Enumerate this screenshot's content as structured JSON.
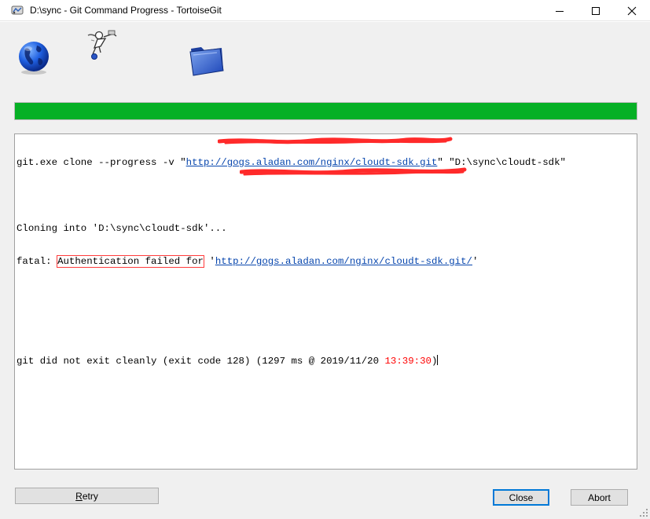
{
  "window": {
    "title": "D:\\sync - Git Command Progress - TortoiseGit"
  },
  "controls": {
    "minimize": "minimize-icon",
    "maximize": "maximize-icon",
    "close": "close-icon"
  },
  "animation_icons": [
    "globe-icon",
    "flying-figure-icon",
    "folder-icon"
  ],
  "progress": {
    "value": 1.0,
    "color": "#06b025"
  },
  "log": {
    "line1_prefix": "git.exe clone --progress -v \"",
    "line1_url": "http://gogs.aladan.com/nginx/cloudt-sdk.git",
    "line1_suffix": "\" \"D:\\sync\\cloudt-sdk\"",
    "line2": "Cloning into 'D:\\sync\\cloudt-sdk'...",
    "line3_prefix": "fatal: ",
    "line3_highlight": "Authentication failed for",
    "line3_mid": " '",
    "line3_url": "http://gogs.aladan.com/nginx/cloudt-sdk.git/",
    "line3_suffix": "'",
    "line4_prefix": "git did not exit cleanly (exit code 128) (1297 ms @ 2019/11/20 ",
    "line4_time": "13:39:30",
    "line4_suffix": ")"
  },
  "buttons": {
    "retry_mnemonic": "R",
    "retry_rest": "etry",
    "close": "Close",
    "abort": "Abort"
  },
  "colors": {
    "accent_red": "#ff0000",
    "link": "#0645ad",
    "progress_green": "#06b025",
    "redaction": "#ff2a2a"
  }
}
